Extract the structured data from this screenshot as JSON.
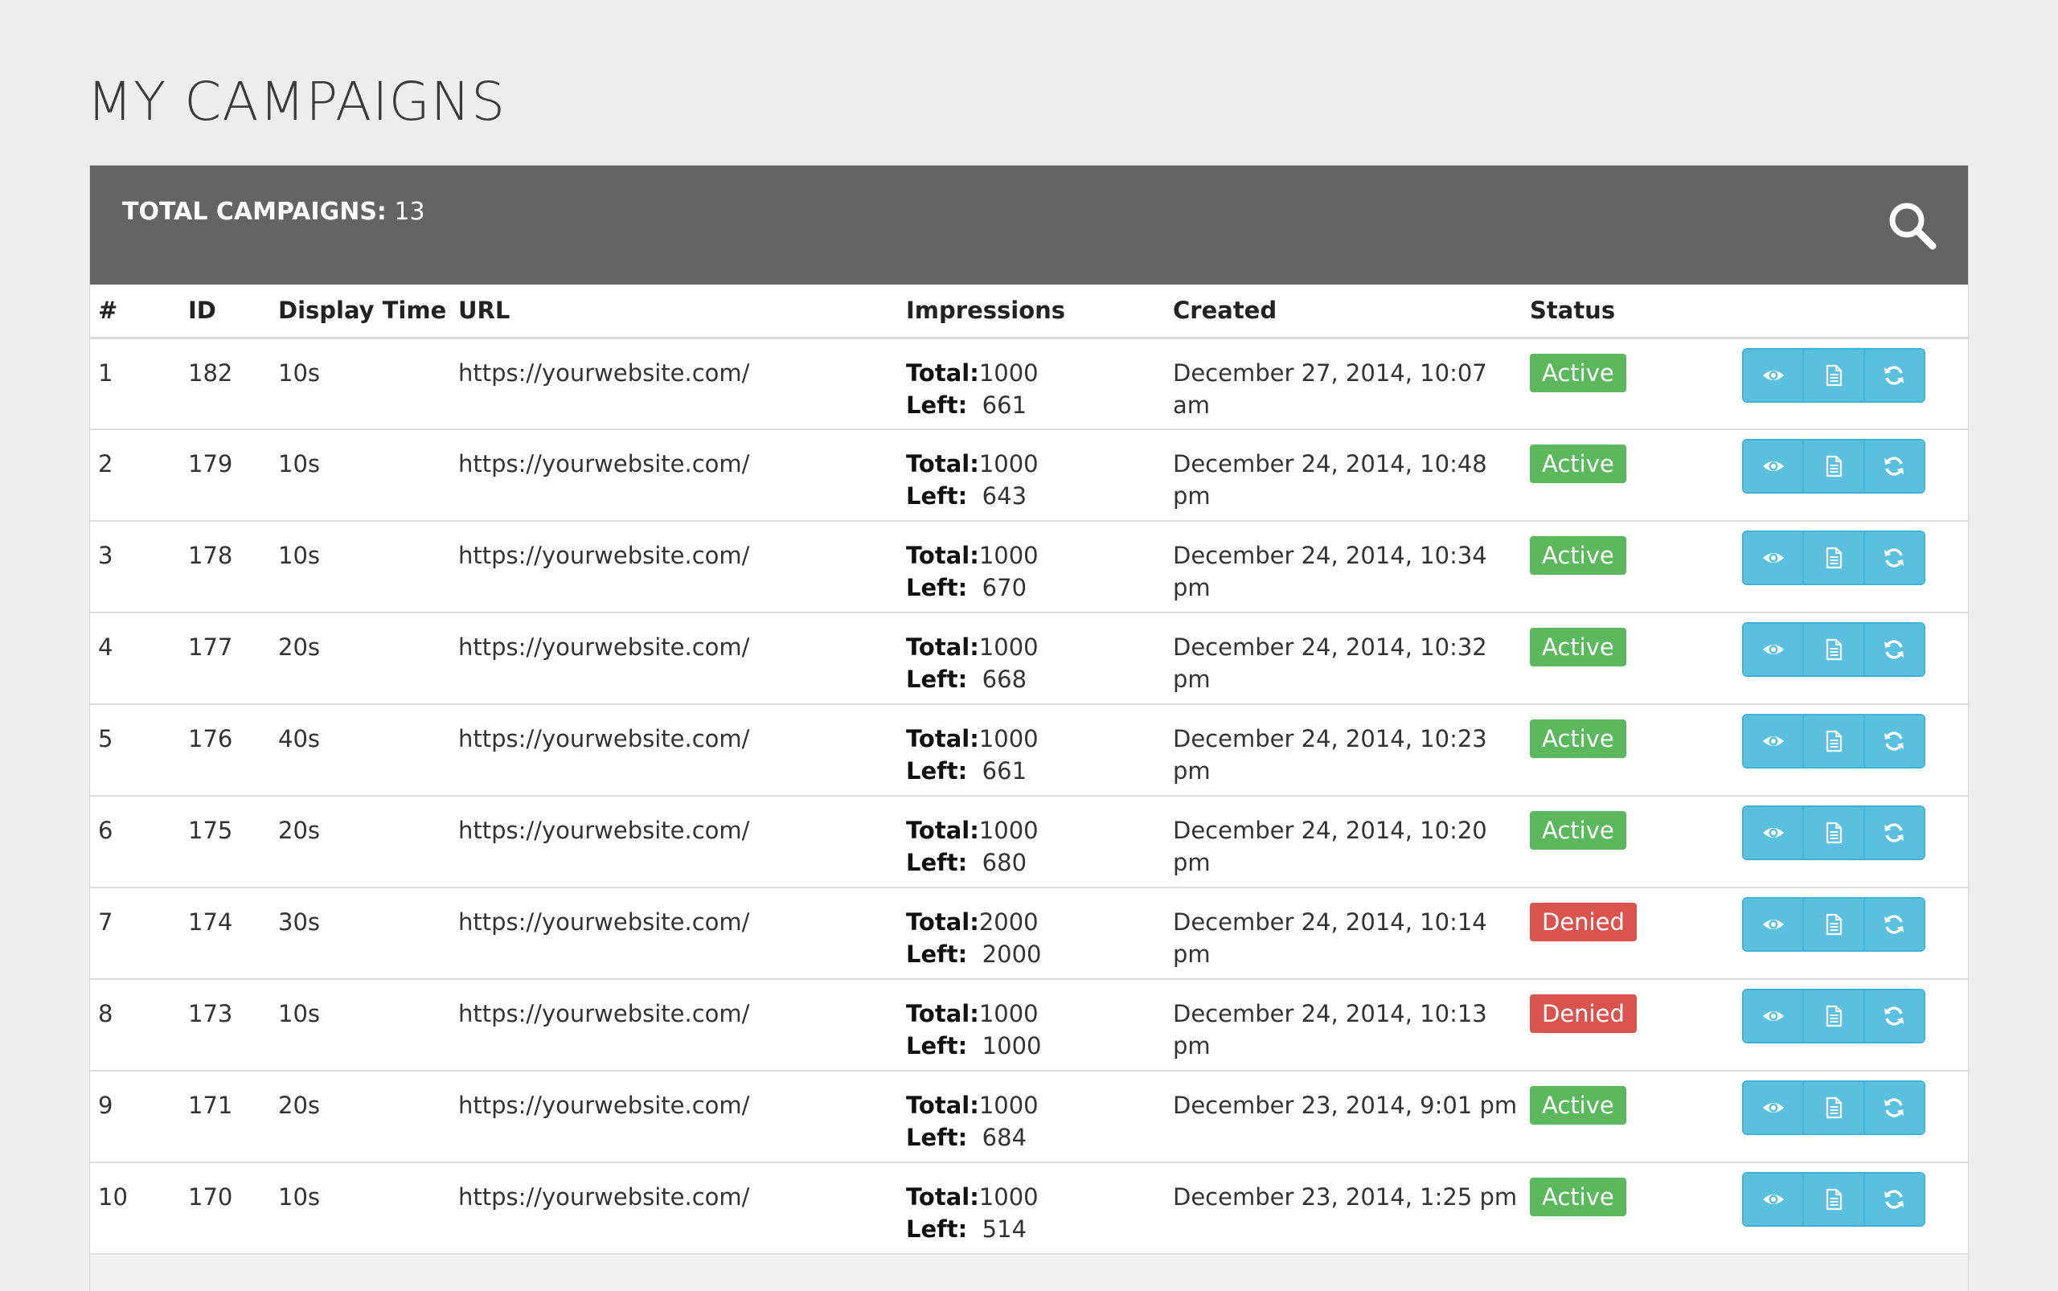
{
  "page": {
    "title": "MY CAMPAIGNS"
  },
  "panel": {
    "total_label": "TOTAL CAMPAIGNS:",
    "total_count": "13",
    "search_icon": "search-icon"
  },
  "table": {
    "columns": [
      "#",
      "ID",
      "Display Time",
      "URL",
      "Impressions",
      "Created",
      "Status",
      ""
    ],
    "impressions_total_label": "Total:",
    "impressions_left_label": "Left:",
    "action_icons": [
      "eye-icon",
      "document-icon",
      "refresh-icon"
    ],
    "status_colors": {
      "Active": "#5cb85c",
      "Denied": "#d9534f"
    },
    "rows": [
      {
        "num": "1",
        "id": "182",
        "display_time": "10s",
        "url": "https://yourwebsite.com/",
        "total": "1000",
        "left": "661",
        "created": "December 27, 2014, 10:07 am",
        "status": "Active"
      },
      {
        "num": "2",
        "id": "179",
        "display_time": "10s",
        "url": "https://yourwebsite.com/",
        "total": "1000",
        "left": "643",
        "created": "December 24, 2014, 10:48 pm",
        "status": "Active"
      },
      {
        "num": "3",
        "id": "178",
        "display_time": "10s",
        "url": "https://yourwebsite.com/",
        "total": "1000",
        "left": "670",
        "created": "December 24, 2014, 10:34 pm",
        "status": "Active"
      },
      {
        "num": "4",
        "id": "177",
        "display_time": "20s",
        "url": "https://yourwebsite.com/",
        "total": "1000",
        "left": "668",
        "created": "December 24, 2014, 10:32 pm",
        "status": "Active"
      },
      {
        "num": "5",
        "id": "176",
        "display_time": "40s",
        "url": "https://yourwebsite.com/",
        "total": "1000",
        "left": "661",
        "created": "December 24, 2014, 10:23 pm",
        "status": "Active"
      },
      {
        "num": "6",
        "id": "175",
        "display_time": "20s",
        "url": "https://yourwebsite.com/",
        "total": "1000",
        "left": "680",
        "created": "December 24, 2014, 10:20 pm",
        "status": "Active"
      },
      {
        "num": "7",
        "id": "174",
        "display_time": "30s",
        "url": "https://yourwebsite.com/",
        "total": "2000",
        "left": "2000",
        "created": "December 24, 2014, 10:14 pm",
        "status": "Denied"
      },
      {
        "num": "8",
        "id": "173",
        "display_time": "10s",
        "url": "https://yourwebsite.com/",
        "total": "1000",
        "left": "1000",
        "created": "December 24, 2014, 10:13 pm",
        "status": "Denied"
      },
      {
        "num": "9",
        "id": "171",
        "display_time": "20s",
        "url": "https://yourwebsite.com/",
        "total": "1000",
        "left": "684",
        "created": "December 23, 2014, 9:01 pm",
        "status": "Active"
      },
      {
        "num": "10",
        "id": "170",
        "display_time": "10s",
        "url": "https://yourwebsite.com/",
        "total": "1000",
        "left": "514",
        "created": "December 23, 2014, 1:25 pm",
        "status": "Active"
      }
    ]
  }
}
